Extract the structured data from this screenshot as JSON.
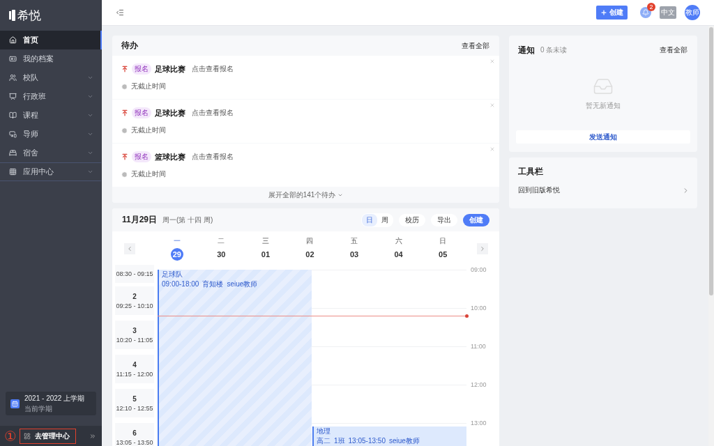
{
  "sidebar": {
    "logo": "希悦",
    "items": [
      {
        "label": "首页",
        "selected": true,
        "expandable": false,
        "divider_before": false
      },
      {
        "label": "我的档案",
        "selected": false,
        "expandable": false,
        "divider_before": false
      },
      {
        "label": "校队",
        "selected": false,
        "expandable": true,
        "divider_before": false
      },
      {
        "label": "行政班",
        "selected": false,
        "expandable": true,
        "divider_before": false
      },
      {
        "label": "课程",
        "selected": false,
        "expandable": true,
        "divider_before": false
      },
      {
        "label": "导师",
        "selected": false,
        "expandable": true,
        "divider_before": false
      },
      {
        "label": "宿舍",
        "selected": false,
        "expandable": true,
        "divider_before": false
      },
      {
        "label": "应用中心",
        "selected": false,
        "expandable": true,
        "divider_before": true
      }
    ],
    "term": {
      "title": "2021 - 2022 上学期",
      "subtitle": "当前学期"
    },
    "admin_link": {
      "label": "去管理中心",
      "marker": "①",
      "highlighted": true
    }
  },
  "topbar": {
    "create_button": "创建",
    "notification_count": "2",
    "language": "中文",
    "avatar": "教师"
  },
  "todo": {
    "title": "待办",
    "view_all": "查看全部",
    "items": [
      {
        "tag": "报名",
        "title": "足球比赛",
        "action": "点击查看报名",
        "deadline": "无截止时间"
      },
      {
        "tag": "报名",
        "title": "足球比赛",
        "action": "点击查看报名",
        "deadline": "无截止时间"
      },
      {
        "tag": "报名",
        "title": "篮球比赛",
        "action": "点击查看报名",
        "deadline": "无截止时间"
      }
    ],
    "expand": "展开全部的141个待办"
  },
  "calendar": {
    "date": "11月29日",
    "subtitle": "周一(第 十四 周)",
    "views": [
      {
        "label": "日",
        "selected": true
      },
      {
        "label": "周",
        "selected": false
      }
    ],
    "buttons": [
      "校历",
      "导出"
    ],
    "create": "创建",
    "days": [
      {
        "weekday": "一",
        "date": "29",
        "selected": true
      },
      {
        "weekday": "二",
        "date": "30",
        "selected": false
      },
      {
        "weekday": "三",
        "date": "01",
        "selected": false
      },
      {
        "weekday": "四",
        "date": "02",
        "selected": false
      },
      {
        "weekday": "五",
        "date": "03",
        "selected": false
      },
      {
        "weekday": "六",
        "date": "04",
        "selected": false
      },
      {
        "weekday": "日",
        "date": "05",
        "selected": false
      }
    ],
    "periods": [
      {
        "time": "08:30 - 09:15"
      },
      {
        "number": "2",
        "time": "09:25 - 10:10"
      },
      {
        "number": "3",
        "time": "10:20 - 11:05"
      },
      {
        "number": "4",
        "time": "11:15 - 12:00"
      },
      {
        "number": "5",
        "time": "12:10 - 12:55"
      },
      {
        "number": "6",
        "time": "13:05 - 13:50"
      }
    ],
    "hours": [
      "09:00",
      "10:00",
      "11:00",
      "12:00",
      "13:00"
    ],
    "events": [
      {
        "kind": "activity",
        "title": "足球队",
        "details": [
          "09:00-18:00",
          "育知楼",
          "seiue教师"
        ]
      },
      {
        "kind": "lesson",
        "title": "地理",
        "details": [
          "高二",
          "1班",
          "13:05-13:50",
          "seiue教师"
        ]
      }
    ]
  },
  "notifications": {
    "title": "通知",
    "unread": "0 条未读",
    "view_all": "查看全部",
    "empty": "暂无新通知",
    "send_button": "发送通知"
  },
  "toolbar": {
    "title": "工具栏",
    "items": [
      "回到旧版希悦"
    ]
  }
}
